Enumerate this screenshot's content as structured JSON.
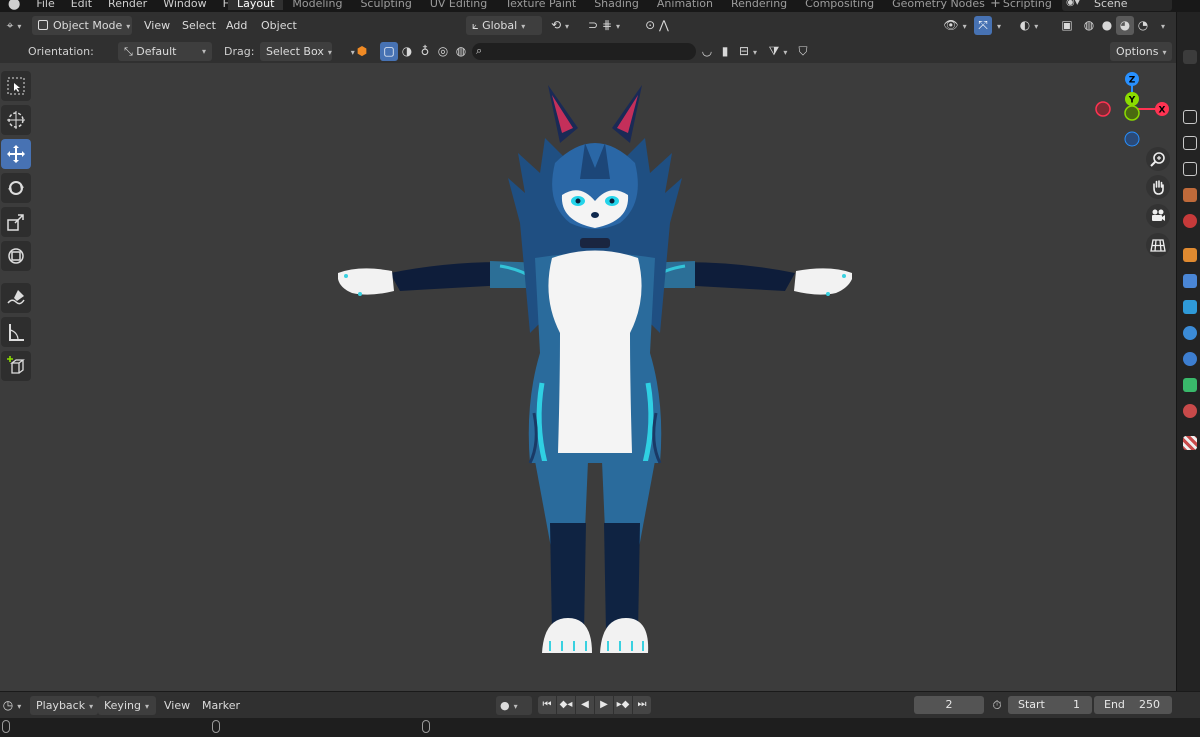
{
  "menu": [
    "File",
    "Edit",
    "Render",
    "Window",
    "Help"
  ],
  "workspace_tabs": [
    {
      "label": "Layout",
      "active": true
    },
    {
      "label": "Modeling"
    },
    {
      "label": "Sculpting"
    },
    {
      "label": "UV Editing"
    },
    {
      "label": "Texture Paint"
    },
    {
      "label": "Shading"
    },
    {
      "label": "Animation"
    },
    {
      "label": "Rendering"
    },
    {
      "label": "Compositing"
    },
    {
      "label": "Geometry Nodes"
    },
    {
      "label": "Scripting"
    }
  ],
  "scene": {
    "label": "Scene"
  },
  "header": {
    "mode": "Object Mode",
    "menus": [
      "View",
      "Select",
      "Add",
      "Object"
    ],
    "transform_orientation": "Global"
  },
  "tool_settings": {
    "orientation_label": "Orientation:",
    "orientation_value": "Default",
    "drag_label": "Drag:",
    "drag_value": "Select Box",
    "options_label": "Options"
  },
  "gizmo": {
    "axis_z": "Z",
    "axis_x": "X",
    "axis_y": "Y",
    "colors": {
      "x": "#ff3352",
      "y": "#8bdc00",
      "z": "#2890ff"
    }
  },
  "timeline": {
    "menus": [
      "Playback",
      "Keying",
      "View",
      "Marker"
    ],
    "current_frame": "2",
    "start_label": "Start",
    "start_value": "1",
    "end_label": "End",
    "end_value": "250"
  },
  "icons": {
    "tools": [
      "select-box-icon",
      "cursor-icon",
      "move-icon",
      "rotate-icon",
      "scale-icon",
      "transform-icon",
      "annotate-icon",
      "measure-icon",
      "add-cube-icon"
    ],
    "nav": [
      "zoom-icon",
      "hand-pan-icon",
      "camera-icon",
      "grid-icon"
    ]
  },
  "colors": {
    "accent": "#4772b3",
    "viewport_bg": "#3c3c3c",
    "header_bg": "#303030"
  }
}
